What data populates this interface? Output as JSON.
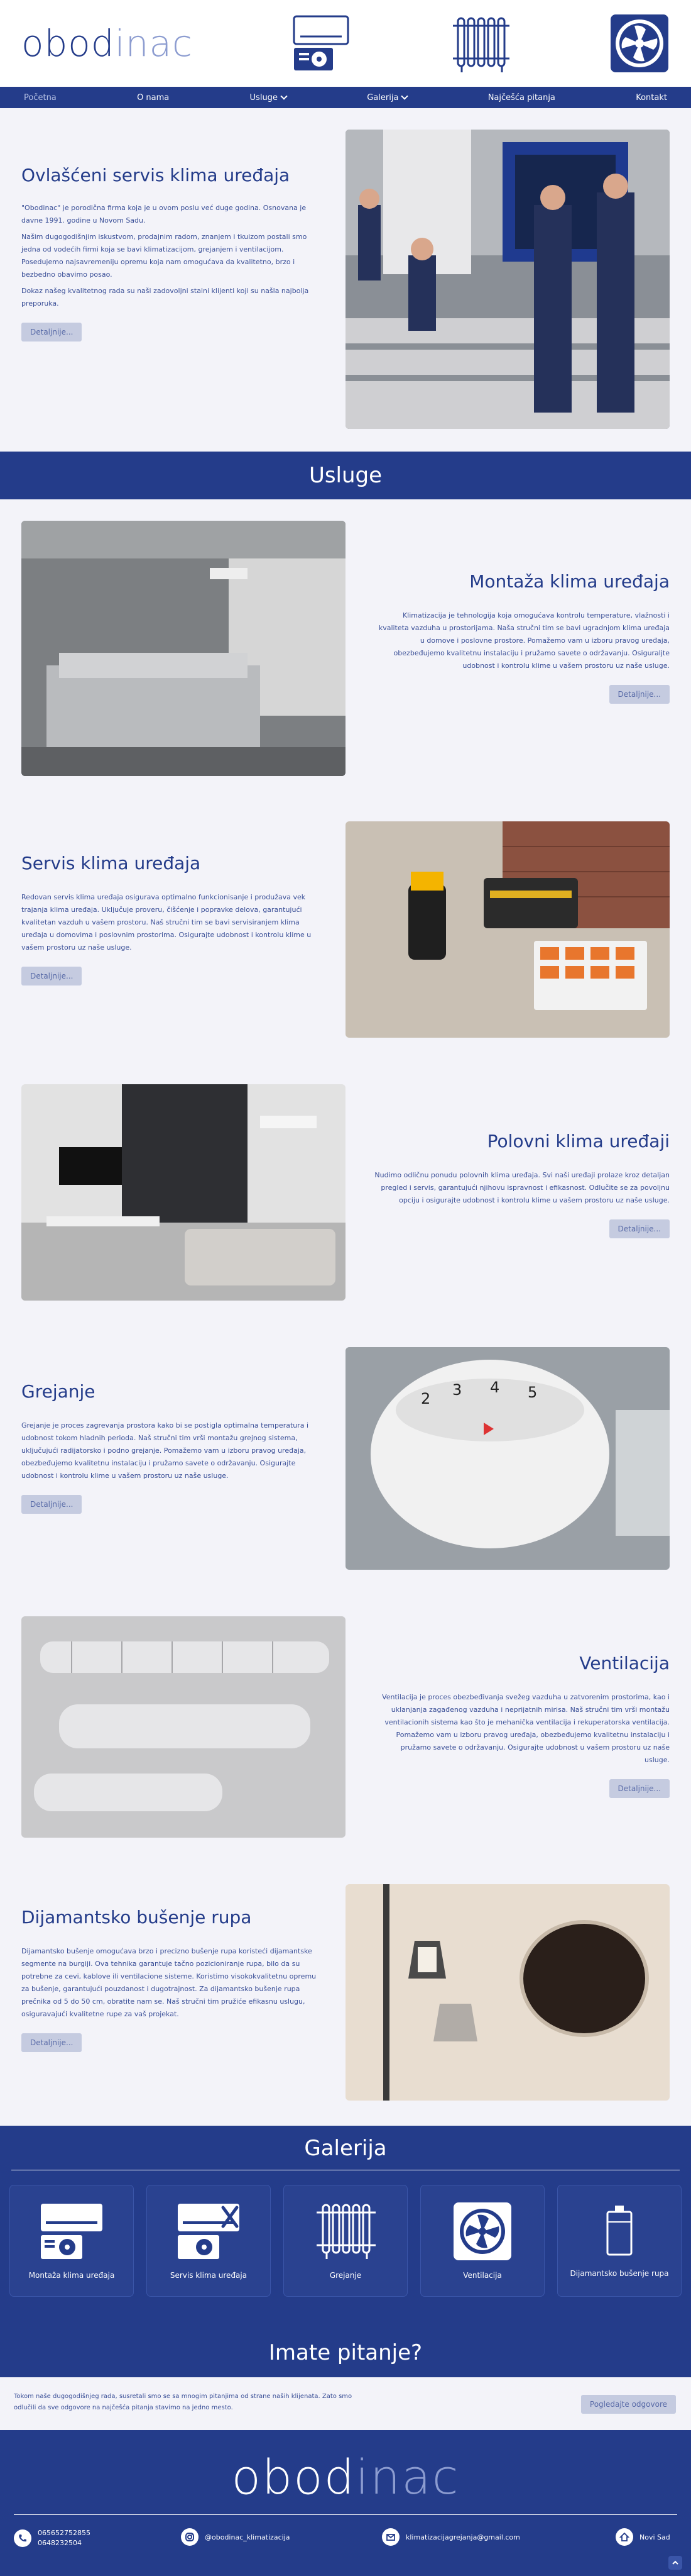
{
  "brand": {
    "logo_dark": "obod",
    "logo_light": "inac"
  },
  "nav": [
    {
      "label": "Početna",
      "dropdown": false
    },
    {
      "label": "O nama",
      "dropdown": false
    },
    {
      "label": "Usluge",
      "dropdown": true
    },
    {
      "label": "Galerija",
      "dropdown": true
    },
    {
      "label": "Najčešća pitanja",
      "dropdown": false
    },
    {
      "label": "Kontakt",
      "dropdown": false
    }
  ],
  "intro": {
    "title": "Ovlašćeni servis klima uređaja",
    "p1": "\"Obodinac\" je porodična firma koja je u ovom poslu već duge godina. Osnovana je davne 1991. godine u Novom Sadu.",
    "p2": "Našim dugogodišnjim iskustvom, prodajnim radom, znanjem i tkuizom postali smo jedna od vodećih firmi koja se bavi klimatizacijom, grejanjem i ventilacijom. Posedujemo najsavremeniju opremu koja nam omogućava da kvalitetno, brzo i bezbedno obavimo posao.",
    "p3": "Dokaz našeg kvalitetnog rada su naši zadovoljni stalni klijenti koji su našla najbolja preporuka.",
    "button": "Detaljnije..."
  },
  "services_title": "Usluge",
  "services": [
    {
      "title": "Montaža klima uređaja",
      "text": "Klimatizacija je tehnologija koja omogućava kontrolu temperature, vlažnosti i kvaliteta vazduha u prostorijama. Naša stručni tim se bavi ugradnjom klima uređaja u domove i poslovne prostore. Pomažemo vam u izboru pravog uređaja, obezbeđujemo kvalitetnu instalaciju i pružamo savete o održavanju. Osiguraljte udobnost i kontrolu klime u vašem prostoru uz naše usluge.",
      "button": "Detaljnije..."
    },
    {
      "title": "Servis klima uređaja",
      "text": "Redovan servis klima uređaja osigurava optimalno funkcionisanje i produžava vek trajanja klima uređaja. Uključuje proveru, čišćenje i popravke delova, garantujući kvalitetan vazduh u vašem prostoru. Naš stručni tim se bavi servisiranjem klima uređaja u domovima i poslovnim prostorima. Osigurajte udobnost i kontrolu klime u vašem prostoru uz naše usluge.",
      "button": "Detaljnije..."
    },
    {
      "title": "Polovni klima uređaji",
      "text": "Nudimo odličnu ponudu polovnih klima uređaja. Svi naši uređaji prolaze kroz detaljan pregled i servis, garantujući njihovu ispravnost i efikasnost. Odlučite se za povoljnu opciju i osigurajte udobnost i kontrolu klime u vašem prostoru uz naše usluge.",
      "button": "Detaljnije..."
    },
    {
      "title": "Grejanje",
      "text": "Grejanje je proces zagrevanja prostora kako bi se postigla optimalna temperatura i udobnost tokom hladnih perioda. Naš stručni tim vrši montažu grejnog sistema, uključujući radijatorsko i podno grejanje. Pomažemo vam u izboru pravog uređaja, obezbeđujemo kvalitetnu instalaciju i pružamo savete o održavanju. Osigurajte udobnost i kontrolu klime u vašem prostoru uz naše usluge.",
      "button": "Detaljnije..."
    },
    {
      "title": "Ventilacija",
      "text": "Ventilacija je proces obezbeđivanja svežeg vazduha u zatvorenim prostorima, kao i uklanjanja zagađenog vazduha i neprijatnih mirisa. Naš stručni tim vrši montažu ventilacionih sistema kao što je mehanička ventilacija i rekuperatorska ventilacija. Pomažemo vam u izboru pravog uređaja, obezbeđujemo kvalitetnu instalaciju i pružamo savete o održavanju. Osigurajte udobnost u vašem prostoru uz naše usluge.",
      "button": "Detaljnije..."
    },
    {
      "title": "Dijamantsko bušenje rupa",
      "text": "Dijamantsko bušenje omogućava brzo i precizno bušenje rupa koristeći dijamantske segmente na burgiji. Ova tehnika garantuje tačno pozicioniranje rupa, bilo da su potrebne za cevi, kablove ili ventilacione sisteme. Koristimo visokokvalitetnu opremu za bušenje, garantujući pouzdanost i dugotrajnost. Za dijamantsko bušenje rupa prečnika od 5 do 50 cm, obratite nam se. Naš stručni tim pružiće efikasnu uslugu, osiguravajući kvalitetne rupe za vaš projekat.",
      "button": "Detaljnije..."
    }
  ],
  "gallery": {
    "title": "Galerija",
    "items": [
      {
        "label": "Montaža klima uređaja",
        "icon": "ac-unit-icon"
      },
      {
        "label": "Servis klima uređaja",
        "icon": "ac-service-icon"
      },
      {
        "label": "Grejanje",
        "icon": "radiator-icon"
      },
      {
        "label": "Ventilacija",
        "icon": "fan-icon"
      },
      {
        "label": "Dijamantsko bušenje rupa",
        "icon": "drill-icon"
      }
    ]
  },
  "faq": {
    "title": "Imate pitanje?",
    "text": "Tokom naše dugogodišnjeg rada, susretali smo se sa mnogim pitanjima od strane naših klijenata. Zato smo odlučili da sve odgovore na najčešća pitanja stavimo na jedno mesto.",
    "button": "Pogledajte odgovore"
  },
  "footer": {
    "phone1": "065652752855",
    "phone2": "0648232504",
    "instagram": "@obodinac_klimatizacija",
    "email": "klimatizacijagrejanja@gmail.com",
    "city": "Novi Sad"
  },
  "colors": {
    "primary": "#243c8a",
    "light": "#8c9cd0",
    "bg": "#f3f3f9",
    "button": "#c5cbe0"
  }
}
